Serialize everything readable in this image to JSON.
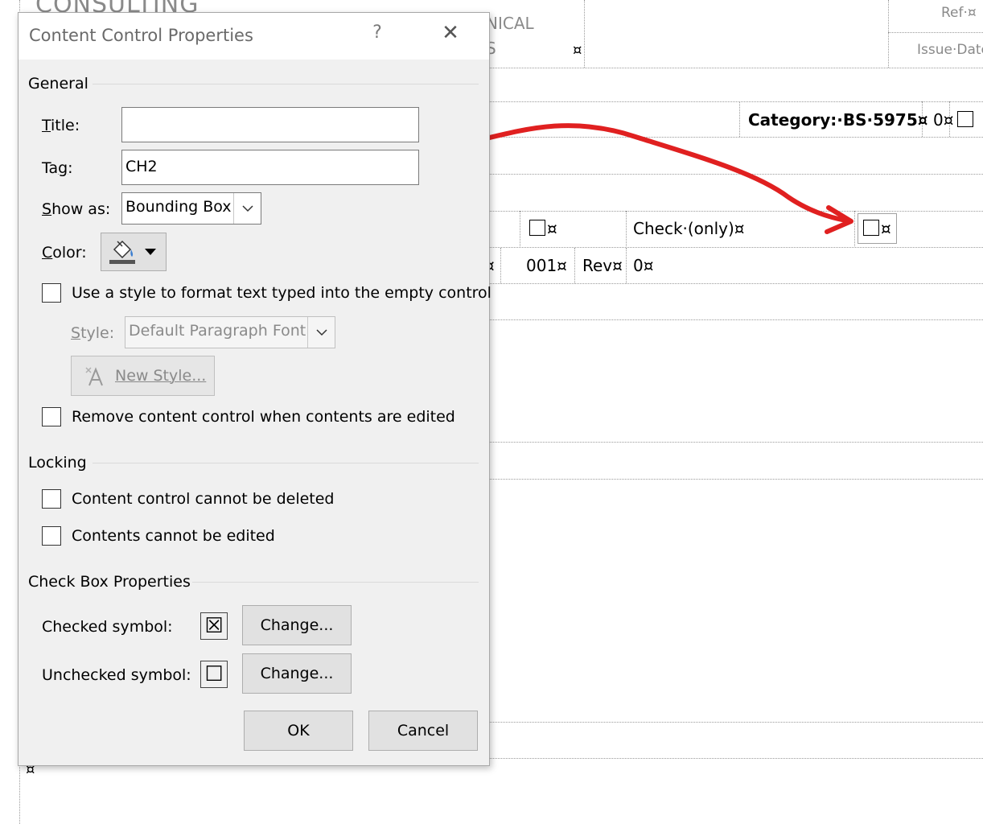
{
  "document": {
    "header_logo_text": "CONSULTING",
    "header_mid_text": "NICAL",
    "header_mid_text_2": "S",
    "mark": "¤",
    "ref_label": "Ref·¤",
    "issue_date_label": "Issue·Date",
    "category_text": "Category:·BS·5975¤",
    "category_num": "0¤",
    "cell_box_1": "¤",
    "check_only_text": "Check·(only)¤",
    "cell_box_2": "¤",
    "row_mark": "¤",
    "code_001": "001¤",
    "rev_label": "Rev¤",
    "rev_value": "0¤",
    "bottom_mark": "¤"
  },
  "annotation": {
    "arrow_color": "#e02020"
  },
  "dialog": {
    "title": "Content Control Properties",
    "help_glyph": "?",
    "close_glyph": "✕",
    "general": {
      "heading": "General",
      "title_label": "Title:",
      "title_value": "",
      "tag_label": "Tag:",
      "tag_value": "CH2",
      "show_as_label": "Show as:",
      "show_as_value": "Bounding Box",
      "color_label": "Color:",
      "use_style_label": "Use a style to format text typed into the empty control",
      "use_style_checked": false,
      "style_label": "Style:",
      "style_value": "Default Paragraph Font",
      "new_style_label": "New Style...",
      "remove_label": "Remove content control when contents are edited",
      "remove_checked": false
    },
    "locking": {
      "heading": "Locking",
      "cannot_delete_label": "Content control cannot be deleted",
      "cannot_delete_checked": false,
      "cannot_edit_label": "Contents cannot be edited",
      "cannot_edit_checked": false
    },
    "checkbox_props": {
      "heading": "Check Box Properties",
      "checked_label": "Checked symbol:",
      "checked_symbol": "☒",
      "unchecked_label": "Unchecked symbol:",
      "unchecked_symbol": "☐",
      "change_label": "Change..."
    },
    "ok_label": "OK",
    "cancel_label": "Cancel"
  }
}
